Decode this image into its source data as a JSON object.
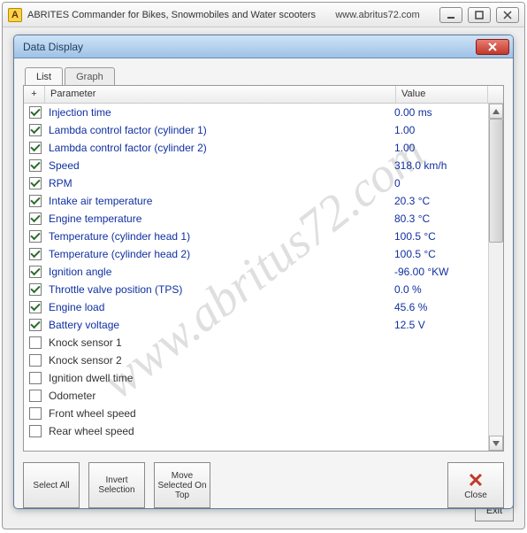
{
  "outer": {
    "title": "ABRITES Commander for Bikes, Snowmobiles and Water scooters",
    "url": "www.abritus72.com",
    "app_icon_letter": "A",
    "exit_label": "Exit"
  },
  "dialog": {
    "title": "Data Display",
    "tabs": {
      "list": "List",
      "graph": "Graph"
    },
    "columns": {
      "plus": "+",
      "parameter": "Parameter",
      "value": "Value"
    },
    "rows": [
      {
        "checked": true,
        "name": "Injection time",
        "value": "0.00 ms"
      },
      {
        "checked": true,
        "name": "Lambda control factor (cylinder 1)",
        "value": "1.00"
      },
      {
        "checked": true,
        "name": "Lambda control factor (cylinder 2)",
        "value": "1.00"
      },
      {
        "checked": true,
        "name": "Speed",
        "value": "318.0 km/h"
      },
      {
        "checked": true,
        "name": "RPM",
        "value": "0"
      },
      {
        "checked": true,
        "name": "Intake air temperature",
        "value": "20.3 °C"
      },
      {
        "checked": true,
        "name": "Engine temperature",
        "value": "80.3 °C"
      },
      {
        "checked": true,
        "name": "Temperature (cylinder head 1)",
        "value": "100.5 °C"
      },
      {
        "checked": true,
        "name": "Temperature (cylinder head 2)",
        "value": "100.5 °C"
      },
      {
        "checked": true,
        "name": "Ignition angle",
        "value": "-96.00 °KW"
      },
      {
        "checked": true,
        "name": "Throttle valve position (TPS)",
        "value": "0.0 %"
      },
      {
        "checked": true,
        "name": "Engine load",
        "value": "45.6 %"
      },
      {
        "checked": true,
        "name": "Battery voltage",
        "value": "12.5 V"
      },
      {
        "checked": false,
        "name": "Knock sensor 1",
        "value": ""
      },
      {
        "checked": false,
        "name": "Knock sensor 2",
        "value": ""
      },
      {
        "checked": false,
        "name": "Ignition dwell time",
        "value": ""
      },
      {
        "checked": false,
        "name": "Odometer",
        "value": ""
      },
      {
        "checked": false,
        "name": "Front wheel speed",
        "value": ""
      },
      {
        "checked": false,
        "name": "Rear wheel speed",
        "value": ""
      }
    ],
    "buttons": {
      "select_all": "Select\nAll",
      "invert_selection": "Invert\nSelection",
      "move_selected_on_top": "Move\nSelected\nOn Top",
      "close": "Close"
    }
  },
  "watermark": "www.abritus72.com"
}
